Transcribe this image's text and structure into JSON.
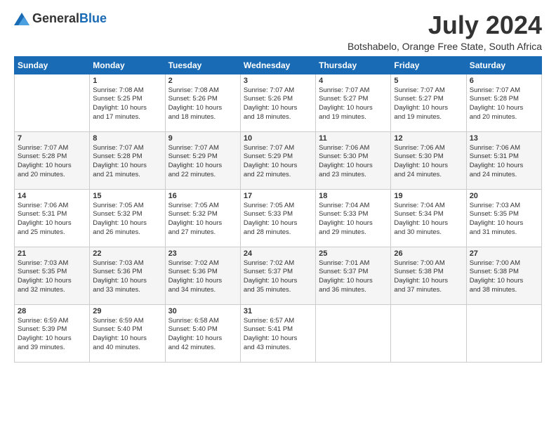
{
  "logo": {
    "general": "General",
    "blue": "Blue"
  },
  "title": {
    "month_year": "July 2024",
    "location": "Botshabelo, Orange Free State, South Africa"
  },
  "weekdays": [
    "Sunday",
    "Monday",
    "Tuesday",
    "Wednesday",
    "Thursday",
    "Friday",
    "Saturday"
  ],
  "weeks": [
    [
      {
        "day": "",
        "info": ""
      },
      {
        "day": "1",
        "info": "Sunrise: 7:08 AM\nSunset: 5:25 PM\nDaylight: 10 hours\nand 17 minutes."
      },
      {
        "day": "2",
        "info": "Sunrise: 7:08 AM\nSunset: 5:26 PM\nDaylight: 10 hours\nand 18 minutes."
      },
      {
        "day": "3",
        "info": "Sunrise: 7:07 AM\nSunset: 5:26 PM\nDaylight: 10 hours\nand 18 minutes."
      },
      {
        "day": "4",
        "info": "Sunrise: 7:07 AM\nSunset: 5:27 PM\nDaylight: 10 hours\nand 19 minutes."
      },
      {
        "day": "5",
        "info": "Sunrise: 7:07 AM\nSunset: 5:27 PM\nDaylight: 10 hours\nand 19 minutes."
      },
      {
        "day": "6",
        "info": "Sunrise: 7:07 AM\nSunset: 5:28 PM\nDaylight: 10 hours\nand 20 minutes."
      }
    ],
    [
      {
        "day": "7",
        "info": "Sunrise: 7:07 AM\nSunset: 5:28 PM\nDaylight: 10 hours\nand 20 minutes."
      },
      {
        "day": "8",
        "info": "Sunrise: 7:07 AM\nSunset: 5:28 PM\nDaylight: 10 hours\nand 21 minutes."
      },
      {
        "day": "9",
        "info": "Sunrise: 7:07 AM\nSunset: 5:29 PM\nDaylight: 10 hours\nand 22 minutes."
      },
      {
        "day": "10",
        "info": "Sunrise: 7:07 AM\nSunset: 5:29 PM\nDaylight: 10 hours\nand 22 minutes."
      },
      {
        "day": "11",
        "info": "Sunrise: 7:06 AM\nSunset: 5:30 PM\nDaylight: 10 hours\nand 23 minutes."
      },
      {
        "day": "12",
        "info": "Sunrise: 7:06 AM\nSunset: 5:30 PM\nDaylight: 10 hours\nand 24 minutes."
      },
      {
        "day": "13",
        "info": "Sunrise: 7:06 AM\nSunset: 5:31 PM\nDaylight: 10 hours\nand 24 minutes."
      }
    ],
    [
      {
        "day": "14",
        "info": "Sunrise: 7:06 AM\nSunset: 5:31 PM\nDaylight: 10 hours\nand 25 minutes."
      },
      {
        "day": "15",
        "info": "Sunrise: 7:05 AM\nSunset: 5:32 PM\nDaylight: 10 hours\nand 26 minutes."
      },
      {
        "day": "16",
        "info": "Sunrise: 7:05 AM\nSunset: 5:32 PM\nDaylight: 10 hours\nand 27 minutes."
      },
      {
        "day": "17",
        "info": "Sunrise: 7:05 AM\nSunset: 5:33 PM\nDaylight: 10 hours\nand 28 minutes."
      },
      {
        "day": "18",
        "info": "Sunrise: 7:04 AM\nSunset: 5:33 PM\nDaylight: 10 hours\nand 29 minutes."
      },
      {
        "day": "19",
        "info": "Sunrise: 7:04 AM\nSunset: 5:34 PM\nDaylight: 10 hours\nand 30 minutes."
      },
      {
        "day": "20",
        "info": "Sunrise: 7:03 AM\nSunset: 5:35 PM\nDaylight: 10 hours\nand 31 minutes."
      }
    ],
    [
      {
        "day": "21",
        "info": "Sunrise: 7:03 AM\nSunset: 5:35 PM\nDaylight: 10 hours\nand 32 minutes."
      },
      {
        "day": "22",
        "info": "Sunrise: 7:03 AM\nSunset: 5:36 PM\nDaylight: 10 hours\nand 33 minutes."
      },
      {
        "day": "23",
        "info": "Sunrise: 7:02 AM\nSunset: 5:36 PM\nDaylight: 10 hours\nand 34 minutes."
      },
      {
        "day": "24",
        "info": "Sunrise: 7:02 AM\nSunset: 5:37 PM\nDaylight: 10 hours\nand 35 minutes."
      },
      {
        "day": "25",
        "info": "Sunrise: 7:01 AM\nSunset: 5:37 PM\nDaylight: 10 hours\nand 36 minutes."
      },
      {
        "day": "26",
        "info": "Sunrise: 7:00 AM\nSunset: 5:38 PM\nDaylight: 10 hours\nand 37 minutes."
      },
      {
        "day": "27",
        "info": "Sunrise: 7:00 AM\nSunset: 5:38 PM\nDaylight: 10 hours\nand 38 minutes."
      }
    ],
    [
      {
        "day": "28",
        "info": "Sunrise: 6:59 AM\nSunset: 5:39 PM\nDaylight: 10 hours\nand 39 minutes."
      },
      {
        "day": "29",
        "info": "Sunrise: 6:59 AM\nSunset: 5:40 PM\nDaylight: 10 hours\nand 40 minutes."
      },
      {
        "day": "30",
        "info": "Sunrise: 6:58 AM\nSunset: 5:40 PM\nDaylight: 10 hours\nand 42 minutes."
      },
      {
        "day": "31",
        "info": "Sunrise: 6:57 AM\nSunset: 5:41 PM\nDaylight: 10 hours\nand 43 minutes."
      },
      {
        "day": "",
        "info": ""
      },
      {
        "day": "",
        "info": ""
      },
      {
        "day": "",
        "info": ""
      }
    ]
  ]
}
